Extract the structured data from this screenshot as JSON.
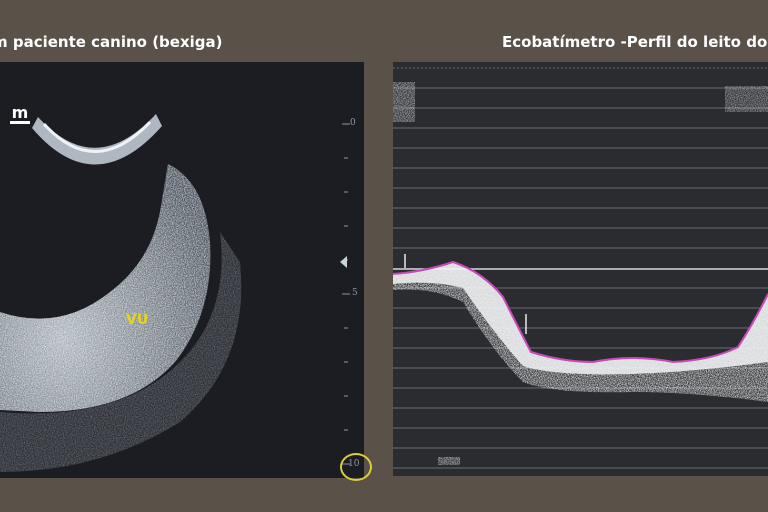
{
  "captions": {
    "left": "m paciente canino (bexiga)",
    "right": "Ecobatímetro -Perfil do leito do"
  },
  "ultrasound": {
    "logo_text": "m",
    "label": "VU",
    "depth_labels": [
      "0",
      "5",
      "10"
    ],
    "colors": {
      "label": "#e7d31b",
      "marker_ring": "#d9cf3a"
    }
  },
  "echosounder": {
    "colors": {
      "bed_outline": "#c84ab8",
      "grid": "#9da3ab"
    }
  }
}
